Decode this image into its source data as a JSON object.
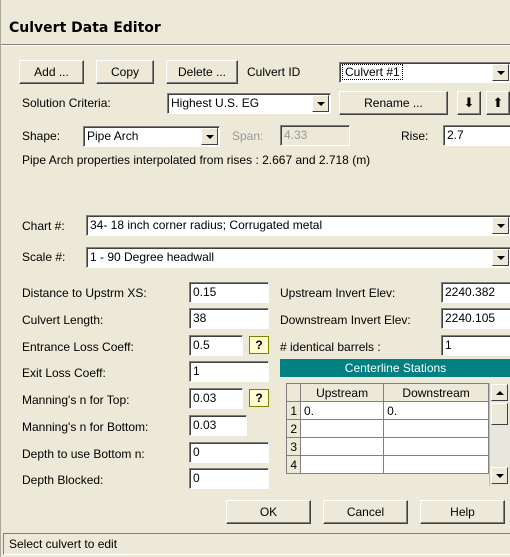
{
  "window": {
    "title": "Culvert Data Editor"
  },
  "toolbar": {
    "add_label": "Add ...",
    "copy_label": "Copy",
    "delete_label": "Delete ...",
    "culvert_id_label": "Culvert ID",
    "culvert_id_value": "Culvert #1",
    "rename_label": "Rename ...",
    "down_arrow": "⬇",
    "up_arrow": "⬆"
  },
  "solution": {
    "label": "Solution Criteria:",
    "value": "Highest U.S. EG"
  },
  "shape": {
    "label": "Shape:",
    "value": "Pipe Arch",
    "span_label": "Span:",
    "span_value": "4.33",
    "rise_label": "Rise:",
    "rise_value": "2.7"
  },
  "info_text": "Pipe Arch properties interpolated from rises : 2.667 and 2.718 (m)",
  "chart": {
    "label": "Chart #:",
    "value": "34- 18 inch corner radius; Corrugated metal"
  },
  "scale": {
    "label": "Scale #:",
    "value": "1 - 90 Degree headwall"
  },
  "left_fields": [
    {
      "label": "Distance to Upstrm XS:",
      "value": "0.15",
      "help": false
    },
    {
      "label": "Culvert Length:",
      "value": "38",
      "help": false
    },
    {
      "label": "Entrance Loss Coeff:",
      "value": "0.5",
      "help": true
    },
    {
      "label": "Exit Loss Coeff:",
      "value": "1",
      "help": false
    },
    {
      "label": "Manning's n for Top:",
      "value": "0.03",
      "help": true
    },
    {
      "label": "Manning's n for Bottom:",
      "value": "0.03",
      "help": false
    },
    {
      "label": "Depth to use Bottom n:",
      "value": "0",
      "help": false
    },
    {
      "label": "Depth Blocked:",
      "value": "0",
      "help": false
    }
  ],
  "right_fields": {
    "upstream_invert_label": "Upstream Invert Elev:",
    "upstream_invert_value": "2240.382",
    "downstream_invert_label": "Downstream Invert Elev:",
    "downstream_invert_value": "2240.105",
    "barrels_label": "# identical barrels :",
    "barrels_value": "1"
  },
  "centerline": {
    "title": "Centerline Stations",
    "col_upstream": "Upstream",
    "col_downstream": "Downstream",
    "rows": [
      {
        "num": "1",
        "up": "0.",
        "down": "0."
      },
      {
        "num": "2",
        "up": "",
        "down": ""
      },
      {
        "num": "3",
        "up": "",
        "down": ""
      },
      {
        "num": "4",
        "up": "",
        "down": ""
      }
    ]
  },
  "buttons": {
    "ok": "OK",
    "cancel": "Cancel",
    "help": "Help"
  },
  "help_glyph": "?",
  "status": "Select culvert to edit"
}
